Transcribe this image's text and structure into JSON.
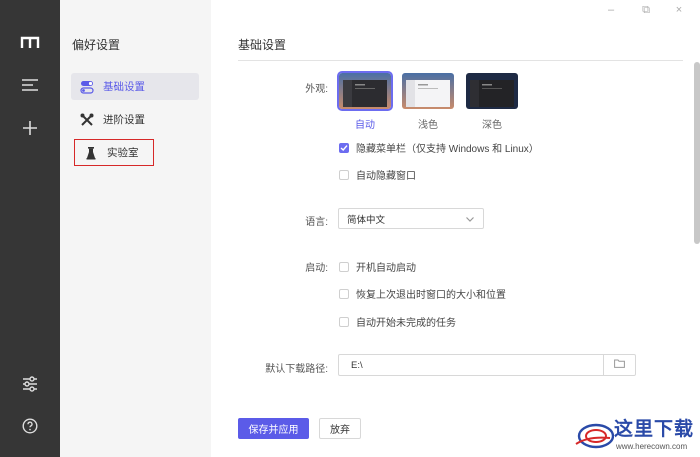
{
  "window": {
    "minimize": "–",
    "maximize": "⧉",
    "close": "×"
  },
  "rail": {
    "icons": [
      "app-logo-icon",
      "menu-icon",
      "plus-icon",
      "sliders-icon",
      "help-icon"
    ]
  },
  "sidebar": {
    "title": "偏好设置",
    "items": [
      {
        "label": "基础设置",
        "icon": "toggle-icon",
        "active": true
      },
      {
        "label": "进阶设置",
        "icon": "tools-icon",
        "active": false
      },
      {
        "label": "实验室",
        "icon": "flask-icon",
        "active": false
      }
    ]
  },
  "main": {
    "title": "基础设置",
    "appearance": {
      "label": "外观:",
      "themes": [
        {
          "caption": "自动",
          "selected": true
        },
        {
          "caption": "浅色",
          "selected": false
        },
        {
          "caption": "深色",
          "selected": false
        }
      ],
      "options": [
        {
          "label": "隐藏菜单栏（仅支持 Windows 和 Linux）",
          "checked": true
        },
        {
          "label": "自动隐藏窗口",
          "checked": false
        }
      ]
    },
    "language": {
      "label": "语言:",
      "value": "简体中文"
    },
    "startup": {
      "label": "启动:",
      "options": [
        {
          "label": "开机自动启动",
          "checked": false
        },
        {
          "label": "恢复上次退出时窗口的大小和位置",
          "checked": false
        },
        {
          "label": "自动开始未完成的任务",
          "checked": false
        }
      ]
    },
    "download_path": {
      "label": "默认下载路径:",
      "value": "E:\\"
    },
    "buttons": {
      "save": "保存并应用",
      "discard": "放弃"
    }
  },
  "watermark": {
    "text": "这里下载",
    "url": "www.herecown.com"
  },
  "colors": {
    "accent": "#5b5be8",
    "rail": "#363636",
    "sidebar": "#f5f5f5",
    "highlight_box": "#d62828"
  }
}
